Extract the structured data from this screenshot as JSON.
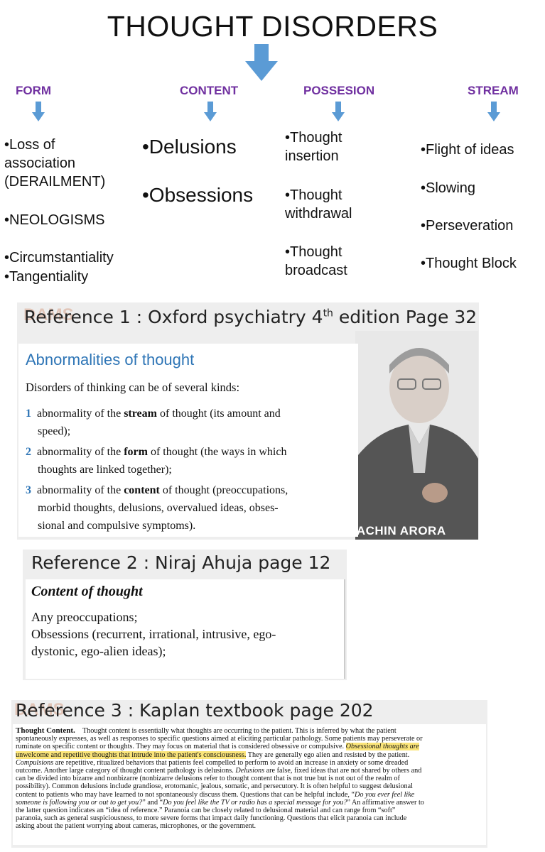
{
  "title": "THOUGHT DISORDERS",
  "categories": {
    "form": {
      "label": "FORM",
      "items": [
        "•Loss of",
        "association",
        "(DERAILMENT)",
        "•NEOLOGISMS",
        "•Circumstantiality",
        "•Tangentiality"
      ]
    },
    "content": {
      "label": "CONTENT",
      "items": [
        "•Delusions",
        "•Obsessions"
      ]
    },
    "possession": {
      "label": "POSSESION",
      "items": [
        "•Thought",
        "insertion",
        "•Thought",
        "withdrawal",
        "•Thought",
        "broadcast"
      ]
    },
    "stream": {
      "label": "STREAM",
      "items": [
        "•Flight of ideas",
        "•Slowing",
        "•Perseveration",
        "•Thought Block"
      ]
    }
  },
  "ref1": {
    "heading_pre": "Reference 1 : Oxford psychiatry 4",
    "heading_sup": "th",
    "heading_post": " edition Page 32",
    "section_title": "Abnormalities of thought",
    "intro": "Disorders of thinking can be of several kinds:",
    "items": [
      {
        "num": "1",
        "pre": "abnormality of the ",
        "bold": "stream",
        "post": " of thought (its amount and",
        "cont": "speed);"
      },
      {
        "num": "2",
        "pre": "abnormality of the ",
        "bold": "form",
        "post": " of thought (the ways in which",
        "cont": "thoughts are linked together);"
      },
      {
        "num": "3",
        "pre": "abnormality of the ",
        "bold": "content",
        "post": " of thought (preoccupations,",
        "cont": "morbid thoughts, delusions, overvalued ideas, obses-",
        "cont2": "sional and compulsive symptoms)."
      }
    ],
    "watermark_name": "SACHIN ARORA",
    "logo_text": "DAMS"
  },
  "ref2": {
    "heading": "Reference 2 : Niraj Ahuja page 12",
    "section_title": "Content of thought",
    "lines": [
      "Any preoccupations;",
      "Obsessions (recurrent, irrational, intrusive, ego-",
      "dystonic, ego-alien ideas);"
    ]
  },
  "ref3": {
    "heading": "Reference 3 : Kaplan textbook page 202",
    "logo_text": "DAMS",
    "lead": "Thought Content.",
    "l1": "Thought content is essentially what thoughts are occurring to the patient. This is inferred by what the patient",
    "l2": "spontaneously expresses, as well as responses to specific questions aimed at eliciting particular pathology. Some patients may perseverate or",
    "l3": "ruminate on specific content or thoughts. They may focus on material that is considered obsessive or compulsive.",
    "l3_hl": "Obsessional thoughts are",
    "l4_hl": "unwelcome and repetitive thoughts that intrude into the patient's consciousness.",
    "l4": "They are generally ego alien and resisted by the patient.",
    "l5_i": "Compulsions",
    "l5": "are repetitive, ritualized behaviors that patients feel compelled to perform to avoid an increase in anxiety or some dreaded",
    "l6a": "outcome. Another large category of thought content pathology is delusions.",
    "l6_i": "Delusions",
    "l6b": "are false, fixed ideas that are not shared by others and",
    "l7": "can be divided into bizarre and nonbizarre (nonbizarre delusions refer to thought content that is not true but is not out of the realm of",
    "l8": "possibility). Common delusions include grandiose, erotomanic, jealous, somatic, and persecutory. It is often helpful to suggest delusional",
    "l9a": "content to patients who may have learned to not spontaneously discuss them. Questions that can be helpful include, “",
    "l9_i": "Do you ever feel like",
    "l10_i": "someone is following you or out to get you?",
    "l10a": "” and “",
    "l10_i2": "Do you feel like the TV or radio has a special message for you?",
    "l10b": "” An affirmative answer to",
    "l11": "the latter question indicates an “idea of reference.” Paranoia can be closely related to delusional material and can range from “soft”",
    "l12": "paranoia, such as general suspiciousness, to more severe forms that impact daily functioning. Questions that elicit paranoia can include",
    "l13": "asking about the patient worrying about cameras, microphones, or the government."
  }
}
